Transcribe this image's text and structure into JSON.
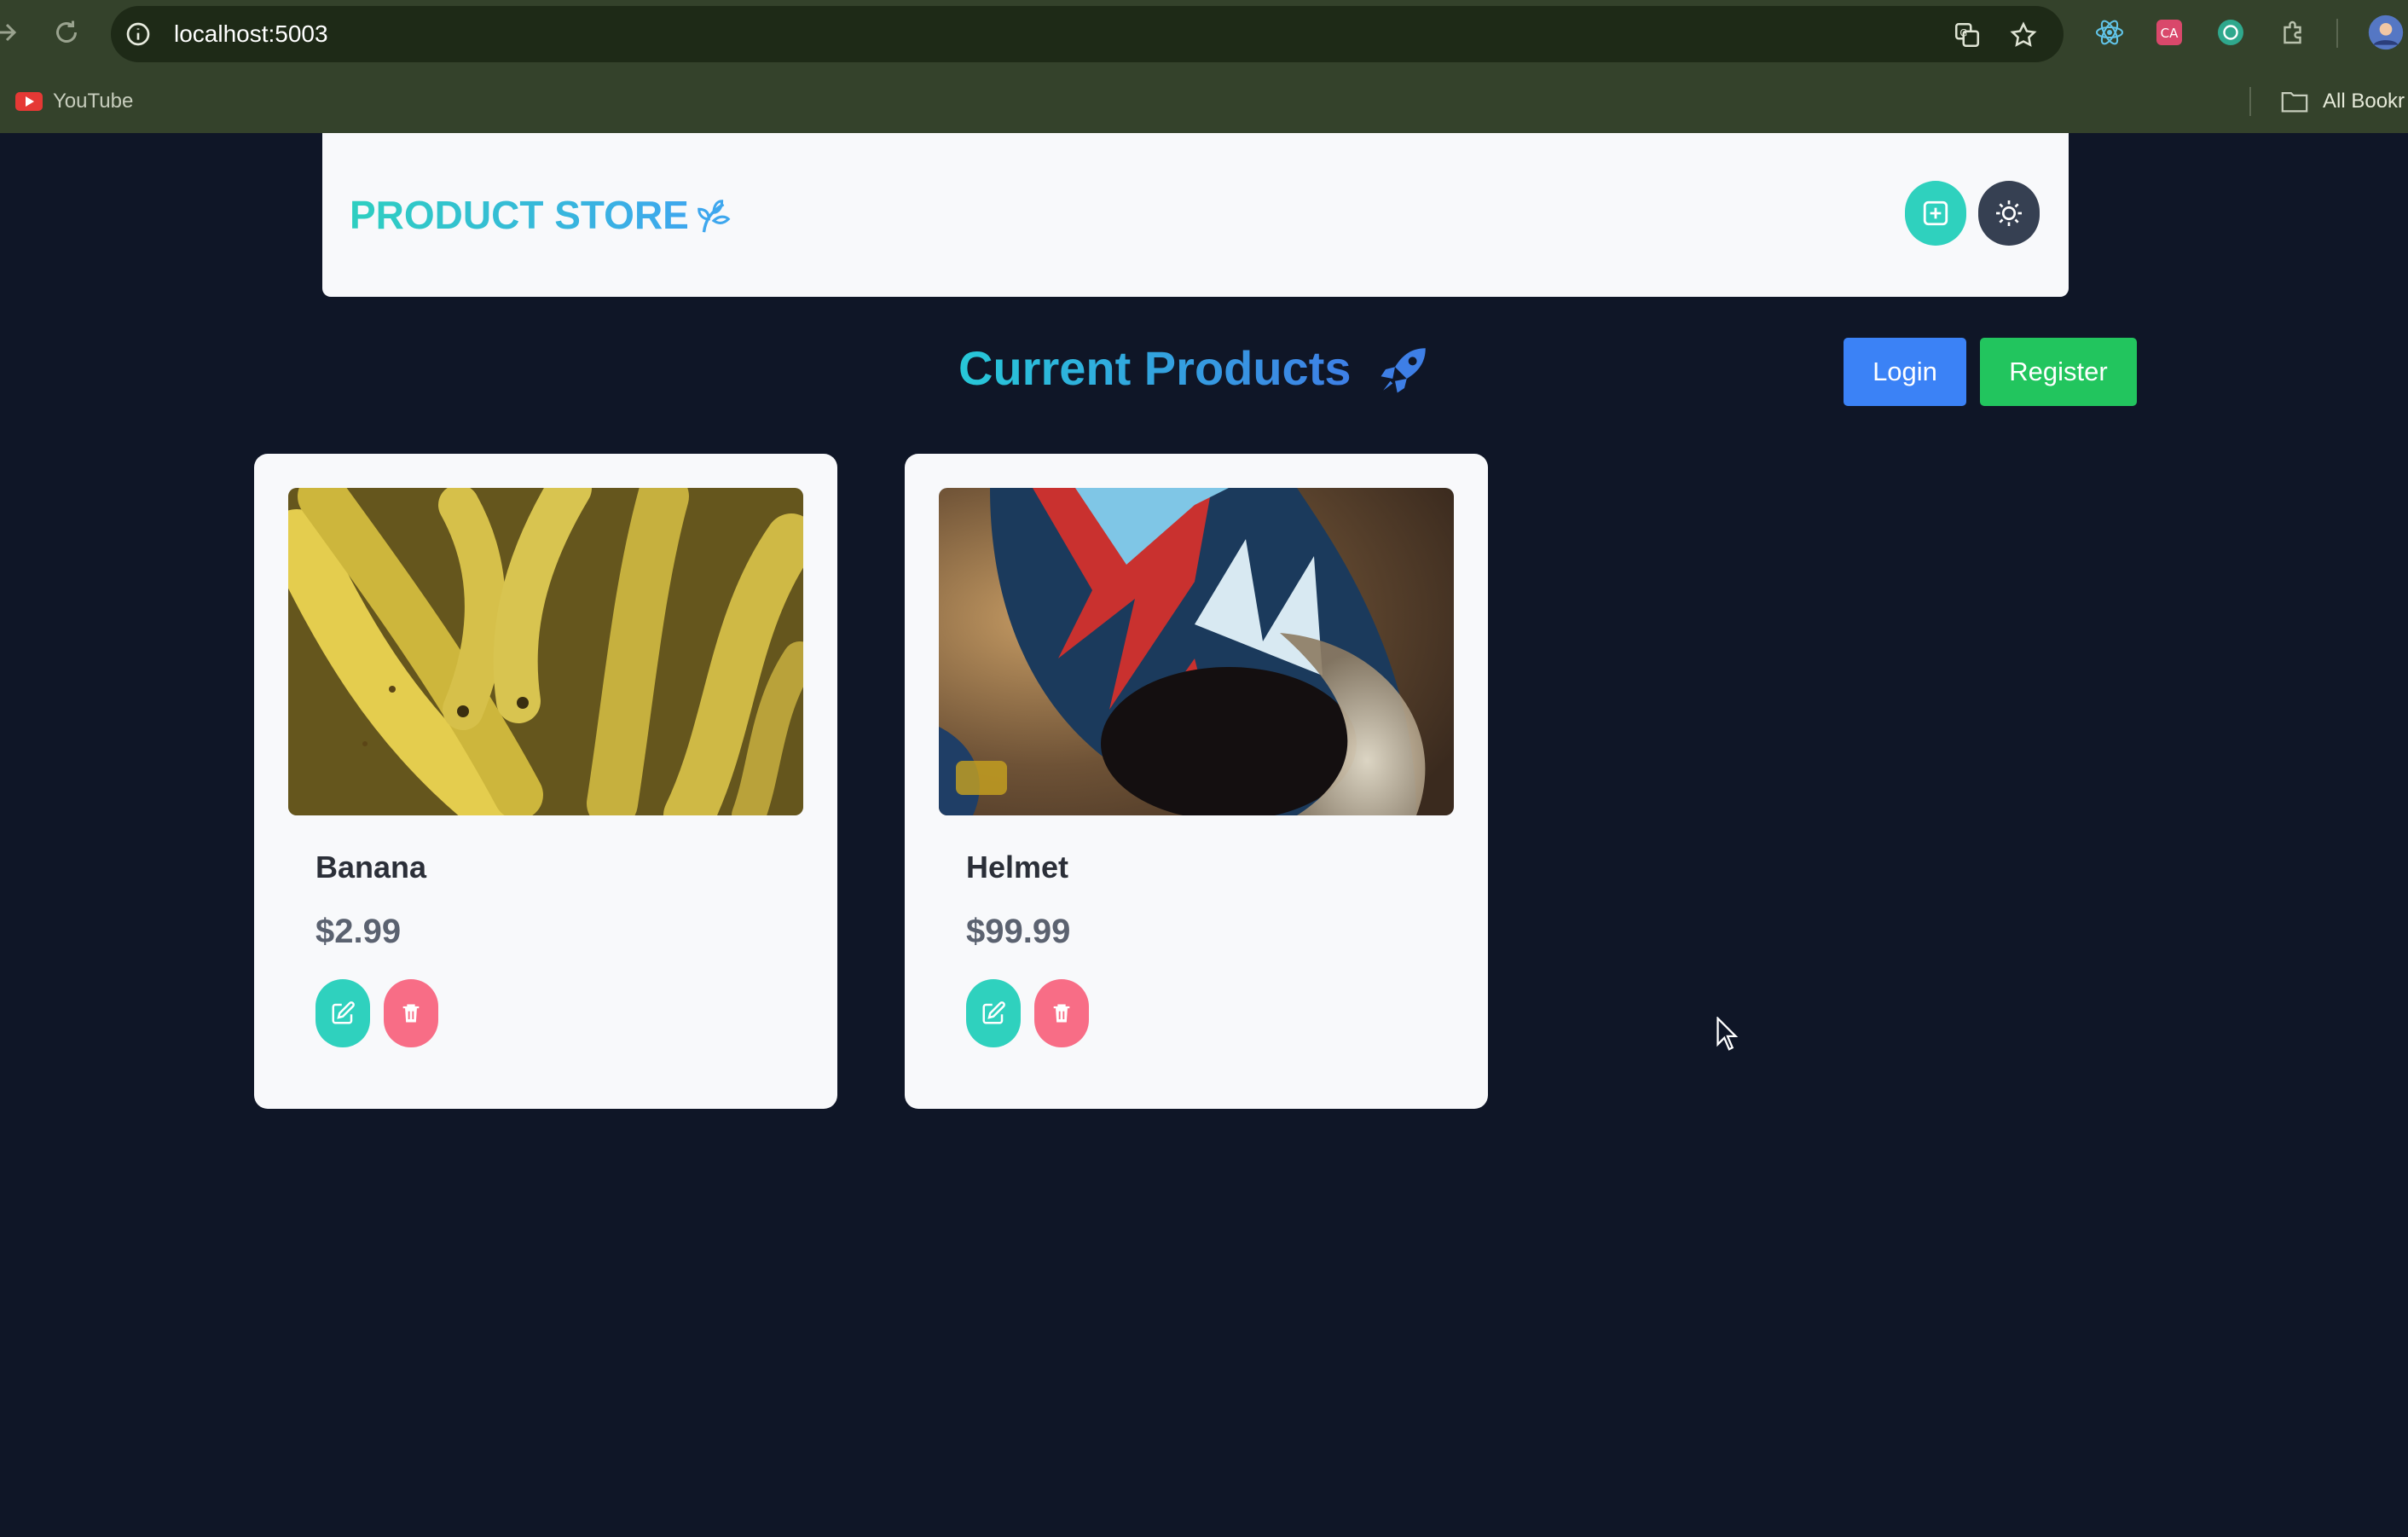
{
  "browser": {
    "url": "localhost:5003",
    "bookmarks": [
      {
        "label": "YouTube",
        "icon": "youtube-icon"
      }
    ],
    "all_bookmarks_label": "All Bookr"
  },
  "navbar": {
    "brand": "PRODUCT STORE",
    "brand_icon": "leaf-icon",
    "add_icon": "plus-square-icon",
    "theme_icon": "sun-icon"
  },
  "main": {
    "title": "Current Products",
    "title_icon": "rocket-icon",
    "login_label": "Login",
    "register_label": "Register"
  },
  "products": [
    {
      "name": "Banana",
      "price": "$2.99",
      "image": "bananas-photo"
    },
    {
      "name": "Helmet",
      "price": "$99.99",
      "image": "motocross-helmet-photo"
    }
  ],
  "colors": {
    "page_bg": "#0f1627",
    "accent_teal": "#2fd1be",
    "login_blue": "#3b82f6",
    "register_green": "#22c55e",
    "delete_pink": "#f86d86",
    "theme_dark": "#364052"
  }
}
